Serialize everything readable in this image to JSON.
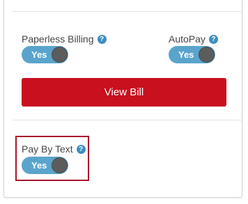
{
  "billing": {
    "paperless": {
      "label": "Paperless Billing",
      "help_icon": "?",
      "toggle_label": "Yes"
    },
    "autopay": {
      "label": "AutoPay",
      "help_icon": "?",
      "toggle_label": "Yes"
    },
    "view_bill_label": "View Bill"
  },
  "pay_by_text": {
    "label": "Pay By Text",
    "help_icon": "?",
    "toggle_label": "Yes"
  },
  "colors": {
    "toggle_on": "#5aa4cc",
    "knob": "#5c5c5c",
    "primary_button": "#c8101e",
    "highlight_border": "#a8162a",
    "help_icon": "#3d8fbf"
  }
}
